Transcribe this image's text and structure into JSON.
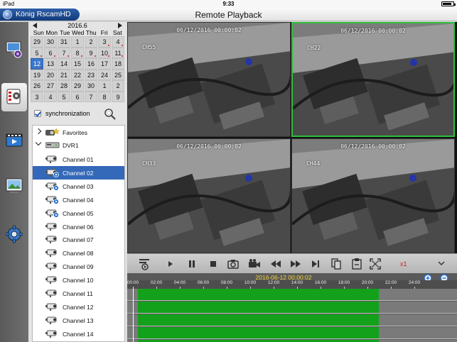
{
  "status_bar": {
    "carrier": "iPad",
    "time": "9:33",
    "battery_level": 0.85
  },
  "app": {
    "brand": "König RscamHD",
    "title": "Remote Playback"
  },
  "rail": [
    {
      "name": "live-view-icon",
      "active": false
    },
    {
      "name": "playback-icon",
      "active": true
    },
    {
      "name": "video-library-icon",
      "active": false
    },
    {
      "name": "image-gallery-icon",
      "active": false
    },
    {
      "name": "settings-icon",
      "active": false
    }
  ],
  "calendar": {
    "month_label": "2016.6",
    "weekdays": [
      "Sun",
      "Mon",
      "Tue",
      "Wed",
      "Thu",
      "Fri",
      "Sat"
    ],
    "days": [
      [
        "29",
        "30",
        "31",
        "1",
        "2",
        "3",
        "4"
      ],
      [
        "5",
        "6",
        "7",
        "8",
        "9",
        "10",
        "11"
      ],
      [
        "12",
        "13",
        "14",
        "15",
        "16",
        "17",
        "18"
      ],
      [
        "19",
        "20",
        "21",
        "22",
        "23",
        "24",
        "25"
      ],
      [
        "26",
        "27",
        "28",
        "29",
        "30",
        "1",
        "2"
      ],
      [
        "3",
        "4",
        "5",
        "6",
        "7",
        "8",
        "9"
      ]
    ],
    "selected": "12",
    "recorded_days": [
      "3",
      "4",
      "5",
      "6",
      "7",
      "8",
      "9",
      "10",
      "11",
      "12"
    ]
  },
  "sync": {
    "label": "synchronization",
    "checked": true
  },
  "tree": {
    "favorites": "Favorites",
    "device": "DVR1",
    "channels": [
      "Channel 01",
      "Channel 02",
      "Channel 03",
      "Channel 04",
      "Channel 05",
      "Channel 06",
      "Channel 07",
      "Channel 08",
      "Channel 09",
      "Channel 10",
      "Channel 11",
      "Channel 12",
      "Channel 13",
      "Channel 14"
    ],
    "selected_channel": "Channel 02",
    "playing_channels": [
      "Channel 02",
      "Channel 03",
      "Channel 04",
      "Channel 05"
    ]
  },
  "videos": [
    {
      "timestamp": "06/12/2016 00:00:02",
      "cam": "CH55",
      "selected": false
    },
    {
      "timestamp": "06/12/2016 00:00:02",
      "cam": "CH22",
      "selected": true
    },
    {
      "timestamp": "06/12/2016 00:00:02",
      "cam": "CH33",
      "selected": false
    },
    {
      "timestamp": "06/12/2016 00:00:02",
      "cam": "CH44",
      "selected": false
    }
  ],
  "controls": {
    "speed": "x1"
  },
  "timeline": {
    "date_time": "2016-06-12 00:00:02",
    "ticks": [
      "00:00",
      "02:00",
      "04:00",
      "06:00",
      "08:00",
      "10:00",
      "12:00",
      "14:00",
      "16:00",
      "18:00",
      "20:00",
      "22:00",
      "24:00"
    ],
    "recording_hours": [
      0.4,
      21
    ],
    "tracks": 5
  }
}
